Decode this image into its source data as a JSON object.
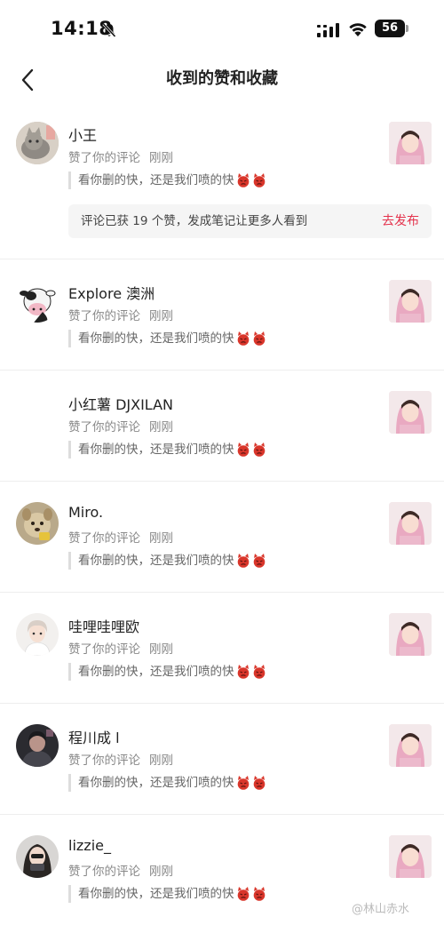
{
  "status_bar": {
    "time": "14:18",
    "battery": "56"
  },
  "header": {
    "title": "收到的赞和收藏"
  },
  "items": [
    {
      "username": "小王",
      "action": "赞了你的评论",
      "time": "刚刚",
      "quote": "看你删的快，还是我们喷的快",
      "avatar_icon": "cat-photo-avatar"
    },
    {
      "username": "Explore 澳洲",
      "action": "赞了你的评论",
      "time": "刚刚",
      "quote": "看你删的快，还是我们喷的快",
      "avatar_icon": "cow-avatar"
    },
    {
      "username": "小红薯 DJXILAN",
      "action": "赞了你的评论",
      "time": "刚刚",
      "quote": "看你删的快，还是我们喷的快",
      "avatar_icon": ""
    },
    {
      "username": "Miro.",
      "action": "赞了你的评论",
      "time": "刚刚",
      "quote": "看你删的快，还是我们喷的快",
      "avatar_icon": "pet-avatar"
    },
    {
      "username": "哇哩哇哩欧",
      "action": "赞了你的评论",
      "time": "刚刚",
      "quote": "看你删的快，还是我们喷的快",
      "avatar_icon": "person-avatar"
    },
    {
      "username": "程川成 l",
      "action": "赞了你的评论",
      "time": "刚刚",
      "quote": "看你删的快，还是我们喷的快",
      "avatar_icon": "dark-person-avatar"
    },
    {
      "username": "lizzie_",
      "action": "赞了你的评论",
      "time": "刚刚",
      "quote": "看你删的快，还是我们喷的快",
      "avatar_icon": "girl-avatar"
    }
  ],
  "promo": {
    "text": "评论已获 19 个赞，发成笔记让更多人看到",
    "link": "去发布"
  },
  "watermark": "@林山赤水",
  "colors": {
    "accent": "#e4324c",
    "emoji": "#d9362b"
  }
}
